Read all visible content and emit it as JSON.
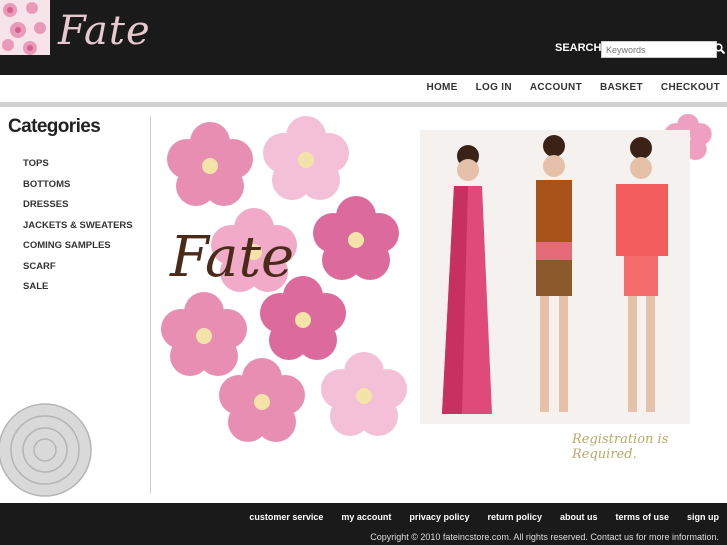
{
  "header": {
    "logo_text": "Fate",
    "search_label": "SEARCH:",
    "search_placeholder": "Keywords"
  },
  "topnav": [
    "HOME",
    "LOG IN",
    "ACCOUNT",
    "BASKET",
    "CHECKOUT"
  ],
  "sidebar": {
    "title": "Categories",
    "items": [
      "TOPS",
      "BOTTOMS",
      "DRESSES",
      "JACKETS & SWEATERS",
      "COMING SAMPLES",
      "SCARF",
      "SALE"
    ]
  },
  "hero": {
    "logo_text": "Fate",
    "registration_note": "Registration is Required."
  },
  "footer": {
    "links": [
      "customer service",
      "my account",
      "privacy policy",
      "return policy",
      "about us",
      "terms of use",
      "sign up"
    ],
    "copyright": "Copyright © 2010 fateincstore.com. All rights reserved. Contact us for more information."
  },
  "colors": {
    "header_bg": "#1a1a1a",
    "logo": "#e6c9cf",
    "flower_pink": "#e06a9a",
    "hero_logo": "#4a2a18"
  }
}
